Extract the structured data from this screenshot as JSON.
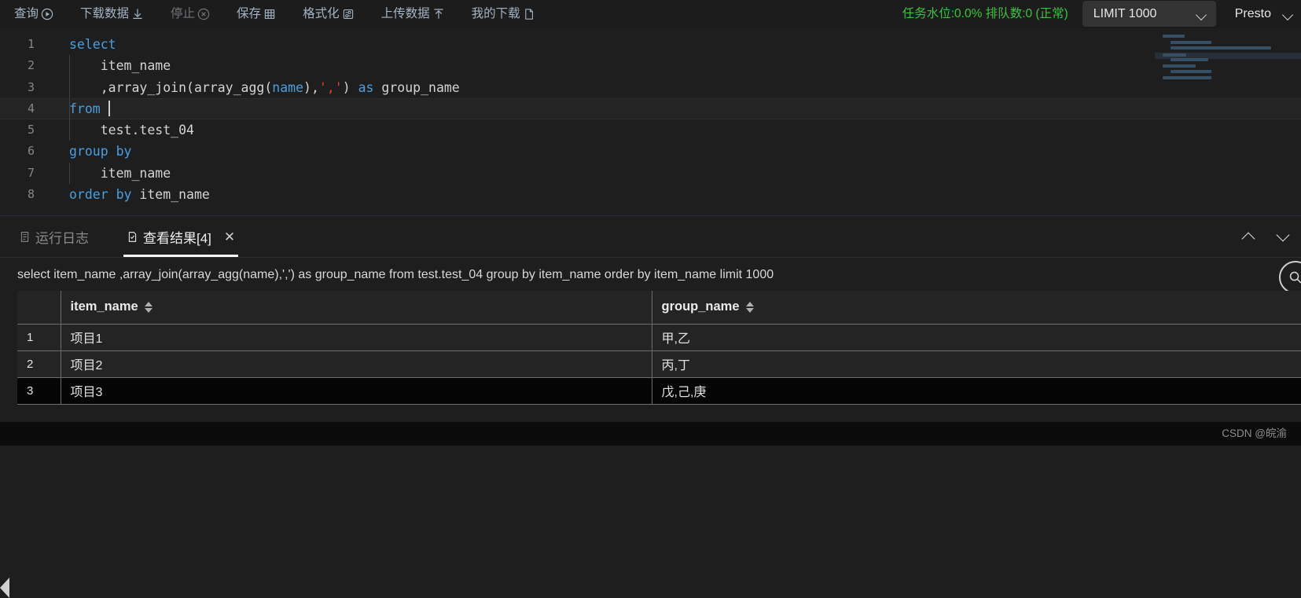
{
  "toolbar": {
    "items": [
      {
        "label": "查询",
        "icon": "play-circle-icon",
        "disabled": false
      },
      {
        "label": "下载数据",
        "icon": "download-icon",
        "disabled": false
      },
      {
        "label": "停止",
        "icon": "stop-circle-icon",
        "disabled": true
      },
      {
        "label": "保存",
        "icon": "grid-save-icon",
        "disabled": false
      },
      {
        "label": "格式化",
        "icon": "format-icon",
        "disabled": false
      },
      {
        "label": "上传数据",
        "icon": "upload-icon",
        "disabled": false
      },
      {
        "label": "我的下载",
        "icon": "document-icon",
        "disabled": false
      }
    ],
    "status_text": "任务水位:0.0% 排队数:0 (正常)",
    "status_color": "#3ec13e",
    "limit_select": "LIMIT 1000",
    "engine_select": "Presto"
  },
  "editor": {
    "lines": [
      {
        "no": "1",
        "active": false,
        "indent": false,
        "tokens": [
          {
            "t": "select",
            "c": "kw"
          }
        ]
      },
      {
        "no": "2",
        "active": false,
        "indent": true,
        "tokens": [
          {
            "t": "    item_name",
            "c": "id"
          }
        ]
      },
      {
        "no": "3",
        "active": false,
        "indent": true,
        "tokens": [
          {
            "t": "    ,array_join(array_agg(",
            "c": "id"
          },
          {
            "t": "name",
            "c": "param"
          },
          {
            "t": "),",
            "c": "id"
          },
          {
            "t": "','",
            "c": "str"
          },
          {
            "t": ") ",
            "c": "id"
          },
          {
            "t": "as",
            "c": "kw"
          },
          {
            "t": " group_name",
            "c": "id"
          }
        ]
      },
      {
        "no": "4",
        "active": true,
        "indent": false,
        "tokens": [
          {
            "t": "from",
            "c": "kw"
          }
        ],
        "caret": true
      },
      {
        "no": "5",
        "active": false,
        "indent": true,
        "tokens": [
          {
            "t": "    test.test_04",
            "c": "id"
          }
        ]
      },
      {
        "no": "6",
        "active": false,
        "indent": false,
        "tokens": [
          {
            "t": "group by",
            "c": "kw"
          }
        ]
      },
      {
        "no": "7",
        "active": false,
        "indent": true,
        "tokens": [
          {
            "t": "    item_name",
            "c": "id"
          }
        ]
      },
      {
        "no": "8",
        "active": false,
        "indent": false,
        "tokens": [
          {
            "t": "order by",
            "c": "kw"
          },
          {
            "t": " item_name",
            "c": "id"
          }
        ]
      }
    ]
  },
  "results": {
    "tabs": [
      {
        "label": "运行日志",
        "icon": "log-document-icon",
        "active": false,
        "closable": false
      },
      {
        "label": "查看结果[4]",
        "icon": "result-document-icon",
        "active": true,
        "closable": true,
        "close_glyph": "✕"
      }
    ],
    "collapse_icon": "chevron-up-icon",
    "expand_icon": "chevron-down-icon",
    "search_icon": "search-icon",
    "query_text": "select item_name ,array_join(array_agg(name),',') as group_name from test.test_04 group by item_name order by item_name limit 1000",
    "table": {
      "columns": [
        "item_name",
        "group_name"
      ],
      "rows": [
        {
          "idx": "1",
          "item_name": "项目1",
          "group_name": "甲,乙",
          "highlight": false
        },
        {
          "idx": "2",
          "item_name": "项目2",
          "group_name": "丙,丁",
          "highlight": false
        },
        {
          "idx": "3",
          "item_name": "项目3",
          "group_name": "戊,己,庚",
          "highlight": true
        }
      ]
    }
  },
  "watermark": "CSDN @皖渝"
}
